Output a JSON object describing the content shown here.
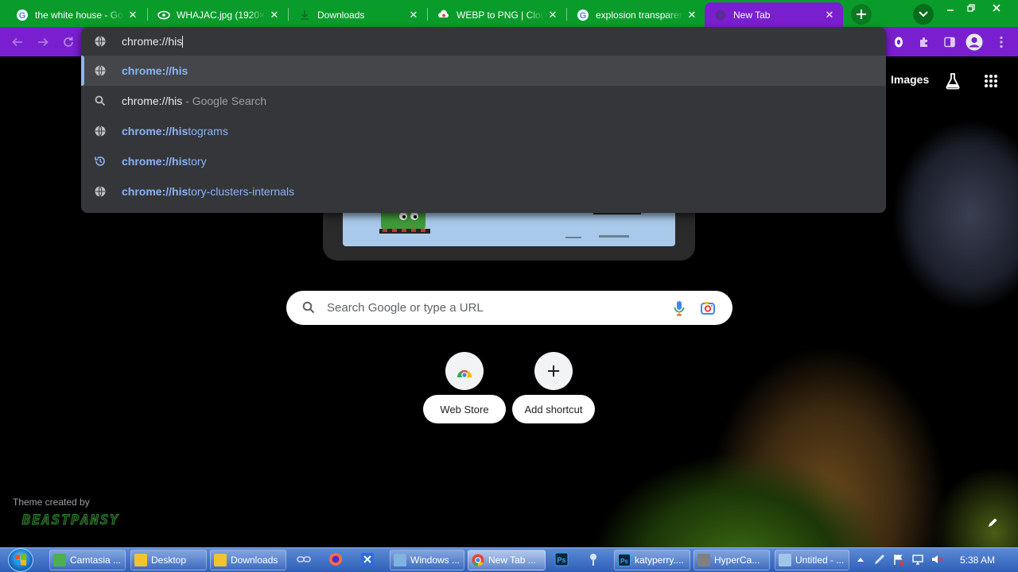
{
  "tabs": [
    {
      "title": "the white house - Go",
      "favicon": "google-icon",
      "active": false
    },
    {
      "title": "WHAJAC.jpg (1920×",
      "favicon": "image-file-icon",
      "active": false
    },
    {
      "title": "Downloads",
      "favicon": "downloads-icon",
      "active": false
    },
    {
      "title": "WEBP to PNG | Clou",
      "favicon": "cloudconvert-icon",
      "active": false
    },
    {
      "title": "explosion transparen",
      "favicon": "google-icon",
      "active": false
    },
    {
      "title": "New Tab",
      "favicon": "chrome-newtab-icon",
      "active": true
    }
  ],
  "omnibox": {
    "input": "chrome://his",
    "suggestions": [
      {
        "icon": "globe-icon",
        "match": "chrome://his",
        "rest": "",
        "desc": "",
        "kind": "url",
        "selected": true
      },
      {
        "icon": "search-icon",
        "match": "chrome://his",
        "rest": "",
        "desc": " - Google Search",
        "kind": "search",
        "selected": false
      },
      {
        "icon": "globe-icon",
        "match": "chrome://his",
        "rest": "tograms",
        "desc": "",
        "kind": "url",
        "selected": false
      },
      {
        "icon": "history-icon",
        "match": "chrome://his",
        "rest": "tory",
        "desc": "",
        "kind": "url",
        "selected": false
      },
      {
        "icon": "globe-icon",
        "match": "chrome://his",
        "rest": "tory-clusters-internals",
        "desc": "",
        "kind": "url",
        "selected": false
      }
    ]
  },
  "ntp": {
    "images_link": "Images",
    "search_placeholder": "Search Google or type a URL",
    "shortcuts": [
      {
        "label": "Web Store",
        "icon": "web-store-icon"
      },
      {
        "label": "Add shortcut",
        "icon": "plus-icon"
      }
    ],
    "theme_credit": "Theme created by",
    "theme_author": "BEASTPANSY"
  },
  "taskbar": {
    "items": [
      {
        "label": "Camtasia ...",
        "color": "#4caf50"
      },
      {
        "label": "Desktop",
        "color": "#f1c232"
      },
      {
        "label": "Downloads",
        "color": "#f1c232"
      },
      {
        "label": "Windows ...",
        "color": "#7fb3e0"
      },
      {
        "label": "New Tab ...",
        "color": "#fbbc05",
        "active": true
      },
      {
        "label": "katyperry....",
        "color": "#1f3a93"
      },
      {
        "label": "HyperCa...",
        "color": "#808080"
      },
      {
        "label": "Untitled - ...",
        "color": "#9fc5e8"
      }
    ],
    "clock": "5:38 AM"
  },
  "colors": {
    "tabstrip": "#0a9c2b",
    "toolbar": "#7a1fd0",
    "omnibox_bg": "#35363a",
    "link_blue": "#8ab4f8"
  }
}
